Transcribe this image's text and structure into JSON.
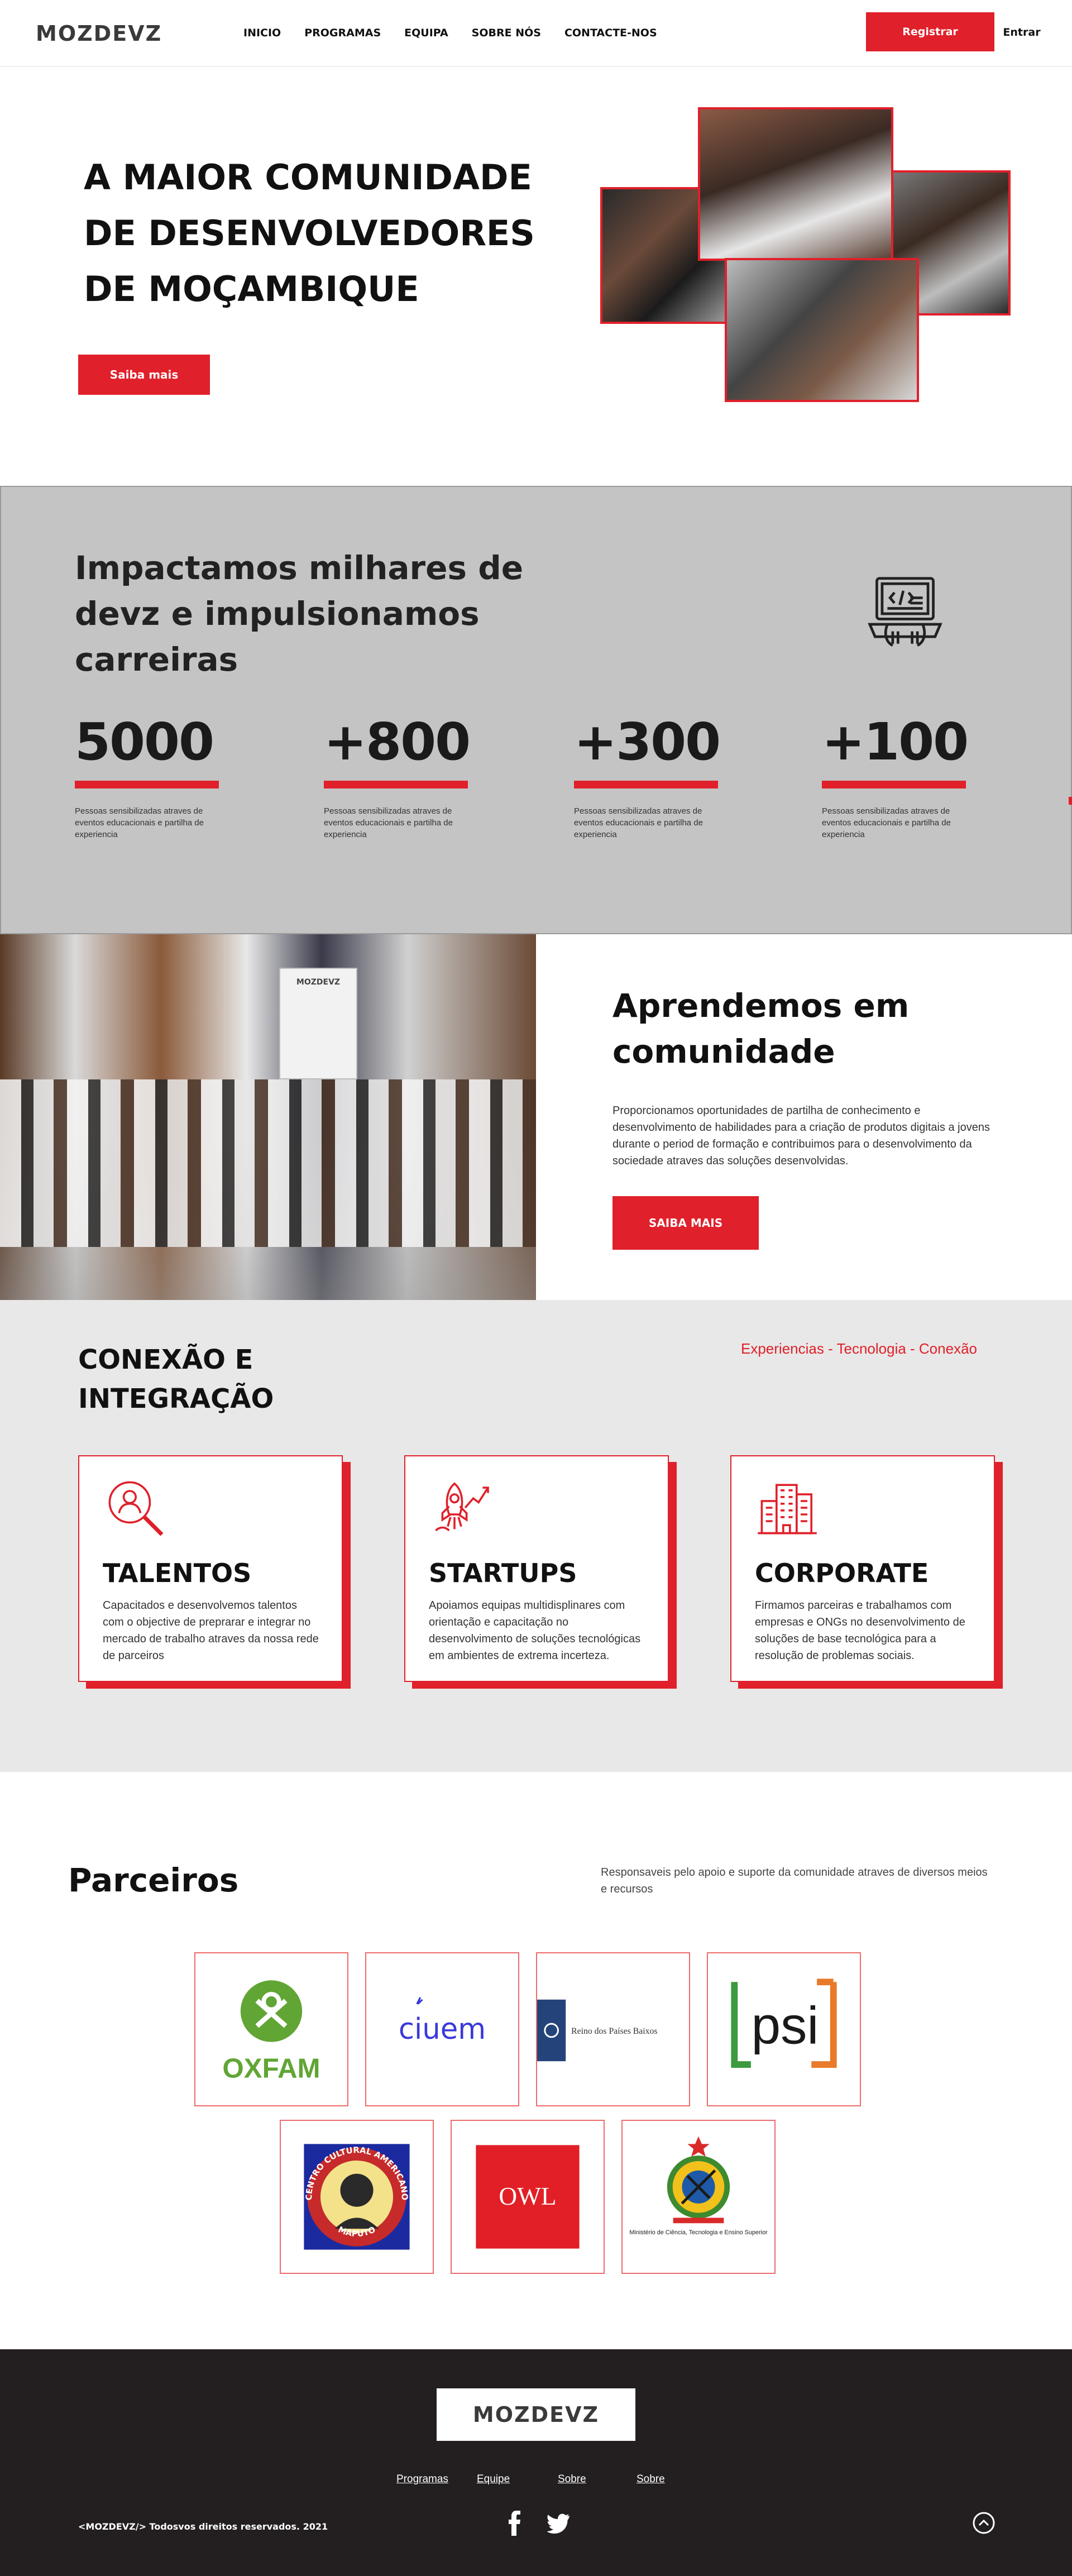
{
  "nav": {
    "logo": "MOZDEVZ",
    "items": [
      "INICIO",
      "PROGRAMAS",
      "EQUIPA",
      "SOBRE NÓS",
      "CONTACTE-NOS"
    ],
    "register_label": "Registrar",
    "login_label": "Entrar"
  },
  "hero": {
    "title_line1": "A MAIOR COMUNIDADE",
    "title_line2": "DE DESENVOLVEDORES",
    "title_line3": "DE MOÇAMBIQUE",
    "button_label": "Saiba mais"
  },
  "stats": {
    "title": "Impactamos milhares de devz e impulsionamos carreiras",
    "items": [
      {
        "value": "5000",
        "description": "Pessoas sensibilizadas atraves de eventos educacionais e partilha de experiencia"
      },
      {
        "value": "+800",
        "description": "Pessoas sensibilizadas atraves de eventos educacionais e partilha de experiencia"
      },
      {
        "value": "+300",
        "description": "Pessoas sensibilizadas atraves de eventos educacionais e partilha de experiencia"
      },
      {
        "value": "+100",
        "description": "Pessoas sensibilizadas atraves de eventos educacionais e partilha de experiencia"
      }
    ]
  },
  "community": {
    "banner_text": "MOZDEVZ",
    "title": "Aprendemos em comunidade",
    "text": "Proporcionamos oportunidades de partilha de conhecimento e desenvolvimento de habilidades para a criação de produtos digitais a jovens durante o period de formação e contribuimos para o desenvolvimento da sociedade atraves das soluções desenvolvidas.",
    "button_label": "SAIBA MAIS"
  },
  "connection": {
    "title": "CONEXÃO E INTEGRAÇÃO",
    "tagline": "Experiencias - Tecnologia - Conexão",
    "cards": [
      {
        "icon": "search-user-icon",
        "title": "TALENTOS",
        "text": "Capacitados e desenvolvemos talentos com o objective de preprarar e integrar no mercado de trabalho atraves da nossa rede de parceiros"
      },
      {
        "icon": "rocket-icon",
        "title": "STARTUPS",
        "text": "Apoiamos equipas multidisplinares  com orientação e capacitação no desenvolvimento de soluções tecnológicas em ambientes de extrema incerteza."
      },
      {
        "icon": "buildings-icon",
        "title": "CORPORATE",
        "text": "Firmamos parceiras e trabalhamos com empresas e ONGs no desenvolvimento de soluções de base tecnológica para a resolução de problemas sociais."
      }
    ]
  },
  "partners": {
    "title": "Parceiros",
    "text": "Responsaveis pelo apoio e suporte da comunidade atraves de diversos meios e recursos",
    "logos": {
      "oxfam": "OXFAM",
      "ciuem": "ciuem",
      "netherlands": "Reino dos Países Baixos",
      "psi": "psi",
      "cca_top": "CENTRO CULTURAL AMERICANO",
      "cca_bottom": "MAPUTO",
      "owl": "OWL",
      "ministry": "Ministério de Ciência, Tecnologia e Ensino Superior"
    }
  },
  "footer": {
    "logo": "MOZDEVZ",
    "links": [
      "Programas",
      "Equipe",
      "Sobre",
      "Sobre"
    ],
    "copyright": "<MOZDEVZ/> Todosvos direitos  reservados. 2021"
  },
  "colors": {
    "accent": "#e0202a",
    "stats_bg": "#c4c4c4",
    "connection_bg": "#e8e8e8",
    "footer_bg": "#231f20"
  }
}
